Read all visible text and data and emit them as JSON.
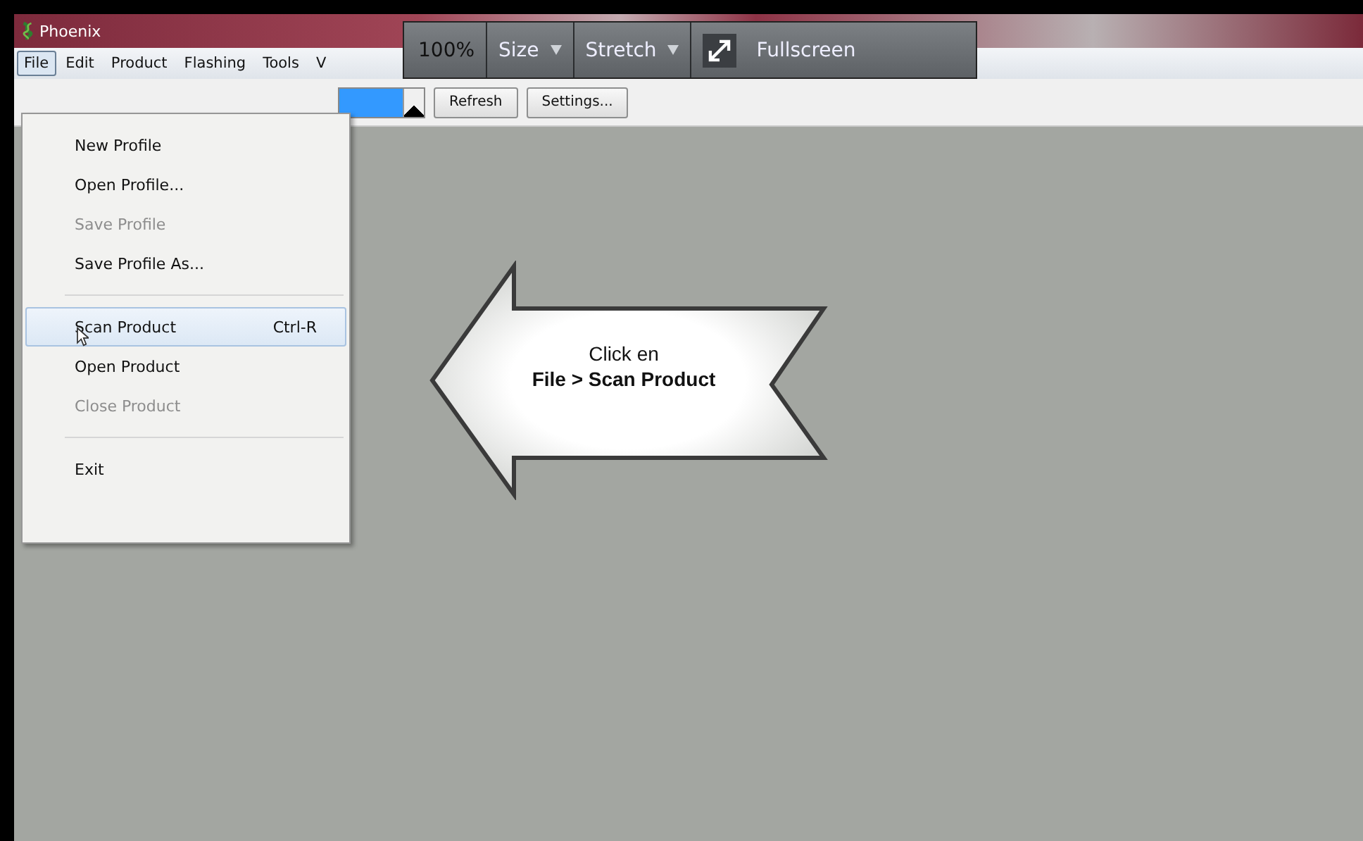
{
  "window": {
    "title": "Phoenix"
  },
  "menu_bar": [
    {
      "label": "File",
      "selected": true
    },
    {
      "label": "Edit",
      "selected": false
    },
    {
      "label": "Product",
      "selected": false
    },
    {
      "label": "Flashing",
      "selected": false
    },
    {
      "label": "Tools",
      "selected": false
    },
    {
      "label": "V",
      "selected": false
    }
  ],
  "toolbar": {
    "combo": {
      "selected": true
    },
    "buttons": [
      "Refresh",
      "Settings..."
    ]
  },
  "file_menu": [
    {
      "kind": "item",
      "label": "New Profile",
      "disabled": false,
      "selected": false
    },
    {
      "kind": "item",
      "label": "Open Profile...",
      "disabled": false,
      "selected": false
    },
    {
      "kind": "item",
      "label": "Save Profile",
      "disabled": true,
      "selected": false
    },
    {
      "kind": "item",
      "label": "Save Profile As...",
      "disabled": false,
      "selected": false
    },
    {
      "kind": "separator"
    },
    {
      "kind": "item",
      "label": "Scan Product",
      "shortcut": "Ctrl-R",
      "disabled": false,
      "selected": true
    },
    {
      "kind": "item",
      "label": "Open Product",
      "disabled": false,
      "selected": false
    },
    {
      "kind": "item",
      "label": "Close Product",
      "disabled": true,
      "selected": false
    },
    {
      "kind": "separator"
    },
    {
      "kind": "item",
      "label": "Exit",
      "disabled": false,
      "selected": false
    }
  ],
  "player_bar": {
    "zoom": "100%",
    "size": "Size",
    "stretch": "Stretch",
    "fullscreen": "Fullscreen"
  },
  "callout": {
    "line_1": "Click en",
    "line_2": "File > Scan Product"
  }
}
